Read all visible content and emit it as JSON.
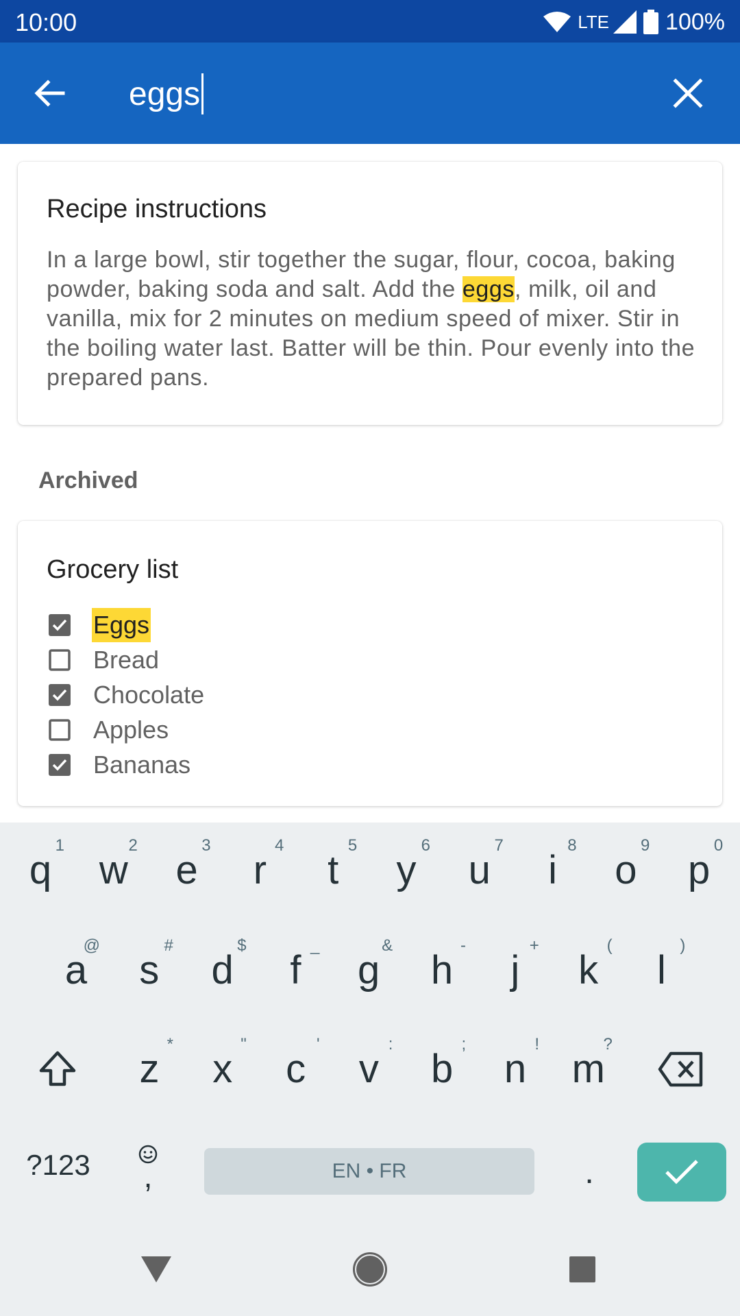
{
  "status_bar": {
    "time": "10:00",
    "network": "LTE",
    "battery": "100%",
    "icons": [
      "wifi-icon",
      "signal-icon",
      "battery-icon"
    ]
  },
  "app_bar": {
    "search_value": "eggs",
    "icons": [
      "back-arrow-icon",
      "close-icon"
    ]
  },
  "cards": [
    {
      "title": "Recipe instructions",
      "body_before": "In a large bowl, stir together the sugar, flour, cocoa, baking powder, baking soda and salt. Add the ",
      "body_highlight": "eggs",
      "body_after": ", milk, oil and vanilla, mix for 2 minutes on medium speed of mixer. Stir in the boiling water last. Batter will be thin. Pour evenly into the prepared pans."
    }
  ],
  "archived_label": "Archived",
  "grocery": {
    "title": "Grocery list",
    "items": [
      {
        "label": "Eggs",
        "checked": true,
        "highlight": true
      },
      {
        "label": "Bread",
        "checked": false
      },
      {
        "label": "Chocolate",
        "checked": true
      },
      {
        "label": "Apples",
        "checked": false
      },
      {
        "label": "Bananas",
        "checked": true
      }
    ]
  },
  "keyboard": {
    "row1": [
      {
        "k": "q",
        "h": "1"
      },
      {
        "k": "w",
        "h": "2"
      },
      {
        "k": "e",
        "h": "3"
      },
      {
        "k": "r",
        "h": "4"
      },
      {
        "k": "t",
        "h": "5"
      },
      {
        "k": "y",
        "h": "6"
      },
      {
        "k": "u",
        "h": "7"
      },
      {
        "k": "i",
        "h": "8"
      },
      {
        "k": "o",
        "h": "9"
      },
      {
        "k": "p",
        "h": "0"
      }
    ],
    "row2": [
      {
        "k": "a",
        "h": "@"
      },
      {
        "k": "s",
        "h": "#"
      },
      {
        "k": "d",
        "h": "$"
      },
      {
        "k": "f",
        "h": "_"
      },
      {
        "k": "g",
        "h": "&"
      },
      {
        "k": "h",
        "h": "-"
      },
      {
        "k": "j",
        "h": "+"
      },
      {
        "k": "k",
        "h": "("
      },
      {
        "k": "l",
        "h": ")"
      }
    ],
    "row3": [
      {
        "k": "z",
        "h": "*"
      },
      {
        "k": "x",
        "h": "\""
      },
      {
        "k": "c",
        "h": "'"
      },
      {
        "k": "v",
        "h": ":"
      },
      {
        "k": "b",
        "h": ";"
      },
      {
        "k": "n",
        "h": "!"
      },
      {
        "k": "m",
        "h": "?"
      }
    ],
    "symbols_label": "?123",
    "emoji_sub": ",",
    "space_label": "EN • FR",
    "period": ".",
    "accent_color": "#4db6ac"
  },
  "theme": {
    "status_bar_color": "#0d47a1",
    "app_bar_color": "#1565c0",
    "highlight_color": "#fdd835"
  }
}
